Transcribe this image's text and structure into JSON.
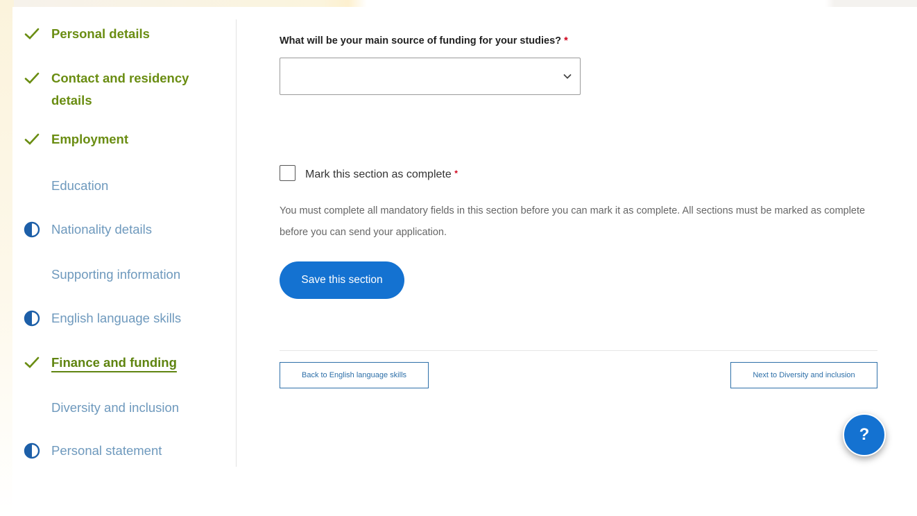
{
  "sidebar": {
    "items": [
      {
        "label": "Personal details",
        "status": "complete"
      },
      {
        "label": "Contact and residency details",
        "status": "complete"
      },
      {
        "label": "Employment",
        "status": "complete"
      },
      {
        "label": "Education",
        "status": "not-started"
      },
      {
        "label": "Nationality details",
        "status": "in-progress"
      },
      {
        "label": "Supporting information",
        "status": "not-started"
      },
      {
        "label": "English language skills",
        "status": "in-progress"
      },
      {
        "label": "Finance and funding",
        "status": "complete-current"
      },
      {
        "label": "Diversity and inclusion",
        "status": "not-started"
      },
      {
        "label": "Personal statement",
        "status": "in-progress"
      }
    ]
  },
  "form": {
    "funding_question": "What will be your main source of funding for your studies?",
    "required_marker": "*",
    "funding_select_value": "",
    "complete_checkbox_label": "Mark this section as complete",
    "complete_checked": false,
    "help_text": "You must complete all mandatory fields in this section before you can mark it as complete. All sections must be marked as complete before you can send your application.",
    "save_label": "Save this section"
  },
  "pager": {
    "back_label": "Back to English language skills",
    "next_label": "Next to Diversity and inclusion"
  },
  "help_button": {
    "label": "?"
  },
  "colors": {
    "complete_green": "#6a8d12",
    "todo_blue": "#6e99bd",
    "primary_blue": "#1472d1",
    "required_red": "#d0021b"
  }
}
